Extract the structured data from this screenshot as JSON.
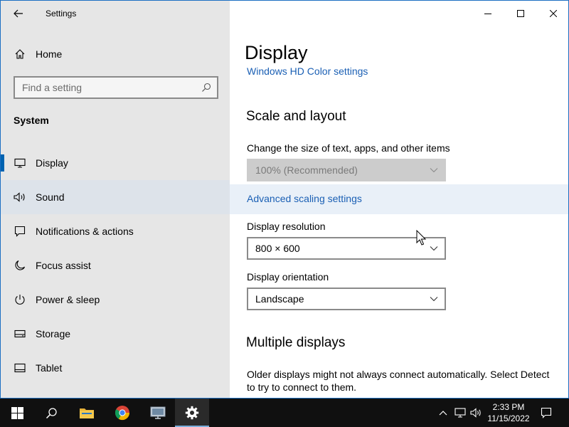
{
  "window": {
    "app_title": "Settings"
  },
  "sidebar": {
    "home_label": "Home",
    "search_placeholder": "Find a setting",
    "section_title": "System",
    "items": [
      {
        "label": "Display"
      },
      {
        "label": "Sound"
      },
      {
        "label": "Notifications & actions"
      },
      {
        "label": "Focus assist"
      },
      {
        "label": "Power & sleep"
      },
      {
        "label": "Storage"
      },
      {
        "label": "Tablet"
      }
    ]
  },
  "main": {
    "page_title": "Display",
    "hdr_link": "Windows HD Color settings",
    "scale_section": "Scale and layout",
    "scale_label": "Change the size of text, apps, and other items",
    "scale_value": "100% (Recommended)",
    "advanced_link": "Advanced scaling settings",
    "resolution_label": "Display resolution",
    "resolution_value": "800 × 600",
    "orientation_label": "Display orientation",
    "orientation_value": "Landscape",
    "multi_section": "Multiple displays",
    "multi_text": "Older displays might not always connect automatically. Select Detect to try to connect to them."
  },
  "taskbar": {
    "time": "2:33 PM",
    "date": "11/15/2022"
  },
  "colors": {
    "accent": "#0063b1",
    "link": "#1a5fb4",
    "sidebar_bg": "#e6e6e6",
    "taskbar_bg": "#101010"
  }
}
